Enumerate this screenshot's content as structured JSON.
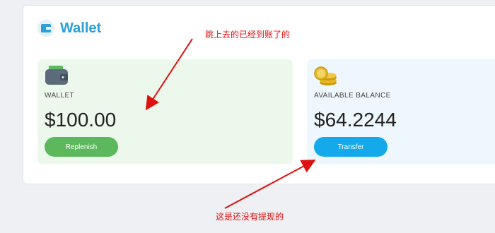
{
  "header": {
    "title": "Wallet",
    "logo_icon": "wallet-app-logo-icon"
  },
  "cards": [
    {
      "icon": "wallet-icon",
      "label": "WALLET",
      "amount": "$100.00",
      "button_label": "Replenish",
      "accent": "#5cb85c"
    },
    {
      "icon": "coins-icon",
      "label": "AVAILABLE BALANCE",
      "amount": "$64.2244",
      "button_label": "Transfer",
      "accent": "#14a9ea"
    }
  ],
  "annotations": {
    "top": "跳上去的已经到账了的",
    "bottom": "这是还没有提现的",
    "color": "#e01010"
  }
}
